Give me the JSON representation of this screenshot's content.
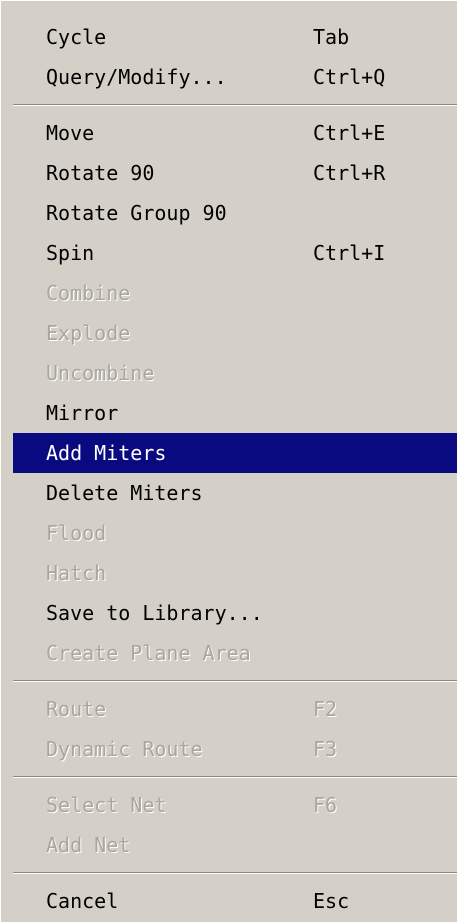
{
  "menu": {
    "items": [
      {
        "label": "Cycle",
        "shortcut": "Tab",
        "state": "enabled"
      },
      {
        "label": "Query/Modify...",
        "shortcut": "Ctrl+Q",
        "state": "enabled"
      },
      {
        "separator": true
      },
      {
        "label": "Move",
        "shortcut": "Ctrl+E",
        "state": "enabled"
      },
      {
        "label": "Rotate 90",
        "shortcut": "Ctrl+R",
        "state": "enabled"
      },
      {
        "label": "Rotate Group 90",
        "shortcut": "",
        "state": "enabled"
      },
      {
        "label": "Spin",
        "shortcut": "Ctrl+I",
        "state": "enabled"
      },
      {
        "label": "Combine",
        "shortcut": "",
        "state": "disabled"
      },
      {
        "label": "Explode",
        "shortcut": "",
        "state": "disabled"
      },
      {
        "label": "Uncombine",
        "shortcut": "",
        "state": "disabled"
      },
      {
        "label": "Mirror",
        "shortcut": "",
        "state": "enabled"
      },
      {
        "label": "Add Miters",
        "shortcut": "",
        "state": "selected"
      },
      {
        "label": "Delete Miters",
        "shortcut": "",
        "state": "enabled"
      },
      {
        "label": "Flood",
        "shortcut": "",
        "state": "disabled"
      },
      {
        "label": "Hatch",
        "shortcut": "",
        "state": "disabled"
      },
      {
        "label": "Save to Library...",
        "shortcut": "",
        "state": "enabled"
      },
      {
        "label": "Create Plane Area",
        "shortcut": "",
        "state": "disabled"
      },
      {
        "separator": true
      },
      {
        "label": "Route",
        "shortcut": "F2",
        "state": "disabled"
      },
      {
        "label": "Dynamic Route",
        "shortcut": "F3",
        "state": "disabled"
      },
      {
        "separator": true
      },
      {
        "label": "Select Net",
        "shortcut": "F6",
        "state": "disabled"
      },
      {
        "label": "Add Net",
        "shortcut": "",
        "state": "disabled"
      },
      {
        "separator": true
      },
      {
        "label": "Cancel",
        "shortcut": "Esc",
        "state": "enabled"
      }
    ]
  }
}
